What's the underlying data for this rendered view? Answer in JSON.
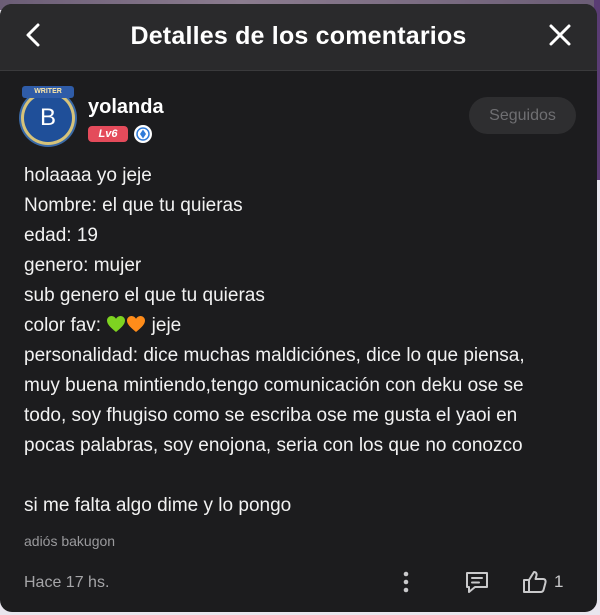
{
  "header": {
    "title": "Detalles de los comentarios",
    "back_icon": "chevron-left-icon",
    "close_icon": "close-icon"
  },
  "author": {
    "name": "yolanda",
    "avatar_letter": "B",
    "avatar_ribbon": "WRITER",
    "level": "Lv6",
    "follow_label": "Seguidos"
  },
  "comment": {
    "lines": [
      "holaaaa yo jeje",
      "Nombre: el que tu quieras",
      "edad: 19",
      "genero: mujer",
      "sub genero el que tu quieras",
      "color fav:",
      "personalidad: dice muchas maldiciónes, dice lo que piensa,",
      "muy buena mintiendo,tengo comunicación con deku ose se",
      "todo, soy fhugiso como se escriba ose me gusta el yaoi en",
      "pocas palabras, soy enojona, seria con los que no conozco",
      "",
      "si me falta algo dime y lo pongo"
    ],
    "color_fav_suffix": "jeje",
    "emojis": [
      "green-heart",
      "orange-heart"
    ],
    "signature": "adiós bakugon"
  },
  "footer": {
    "time": "Hace 17 hs.",
    "likes": "1"
  },
  "colors": {
    "panel_bg": "#1c1c1e",
    "header_bg": "#2a2a2c",
    "level_badge": "#e44b5b",
    "green_heart": "#7ed321",
    "orange_heart": "#ff8c1a"
  }
}
